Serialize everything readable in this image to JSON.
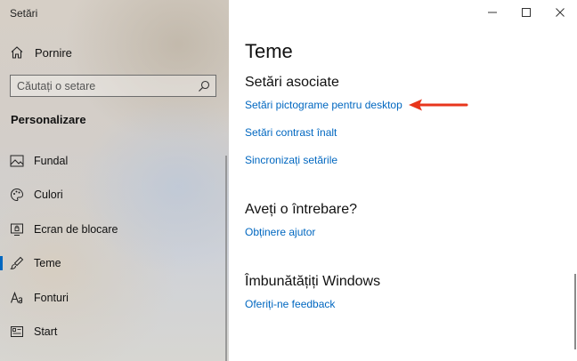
{
  "app_title": "Setări",
  "sidebar": {
    "home_label": "Pornire",
    "search_placeholder": "Căutați o setare",
    "section_title": "Personalizare",
    "items": [
      {
        "label": "Fundal",
        "icon": "picture-icon"
      },
      {
        "label": "Culori",
        "icon": "palette-icon"
      },
      {
        "label": "Ecran de blocare",
        "icon": "lock-screen-icon"
      },
      {
        "label": "Teme",
        "icon": "themes-icon",
        "active": true
      },
      {
        "label": "Fonturi",
        "icon": "font-icon"
      },
      {
        "label": "Start",
        "icon": "start-icon"
      }
    ]
  },
  "main": {
    "title": "Teme",
    "related_heading": "Setări asociate",
    "related_links": [
      "Setări pictograme pentru desktop",
      "Setări contrast înalt",
      "Sincronizați setările"
    ],
    "question_heading": "Aveți o întrebare?",
    "help_link": "Obținere ajutor",
    "improve_heading": "Îmbunătățiți Windows",
    "feedback_link": "Oferiți-ne feedback"
  },
  "colors": {
    "accent": "#0067c0",
    "annotation_arrow": "#e8361c"
  }
}
